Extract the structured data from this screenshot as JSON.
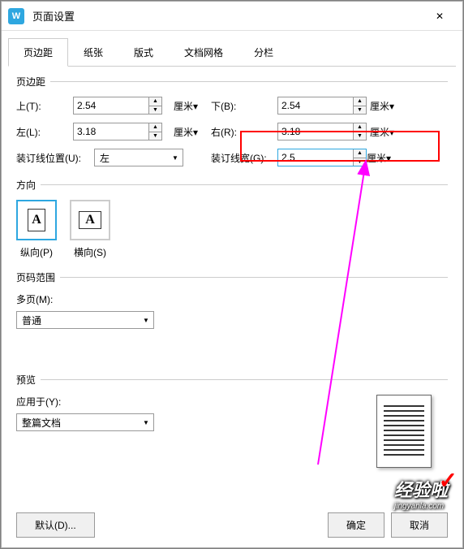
{
  "window": {
    "title": "页面设置",
    "app_icon": "W"
  },
  "tabs": [
    "页边距",
    "纸张",
    "版式",
    "文档网格",
    "分栏"
  ],
  "margins": {
    "section_label": "页边距",
    "top": {
      "label": "上(T):",
      "value": "2.54",
      "unit": "厘米▾"
    },
    "bottom": {
      "label": "下(B):",
      "value": "2.54",
      "unit": "厘米▾"
    },
    "left": {
      "label": "左(L):",
      "value": "3.18",
      "unit": "厘米▾"
    },
    "right": {
      "label": "右(R):",
      "value": "3.18",
      "unit": "厘米▾"
    },
    "gutter_pos": {
      "label": "装订线位置(U):",
      "value": "左"
    },
    "gutter_width": {
      "label": "装订线宽(G):",
      "value": "2.5",
      "unit": "厘米▾"
    }
  },
  "orientation": {
    "section_label": "方向",
    "portrait": "纵向(P)",
    "landscape": "横向(S)",
    "glyph": "A"
  },
  "page_range": {
    "section_label": "页码范围",
    "multipage_label": "多页(M):",
    "multipage_value": "普通"
  },
  "preview": {
    "section_label": "预览",
    "apply_label": "应用于(Y):",
    "apply_value": "整篇文档"
  },
  "footer": {
    "defaults": "默认(D)...",
    "ok": "确定",
    "cancel": "取消"
  },
  "watermark": {
    "big": "经验啦",
    "small": "jingyanla.com"
  }
}
